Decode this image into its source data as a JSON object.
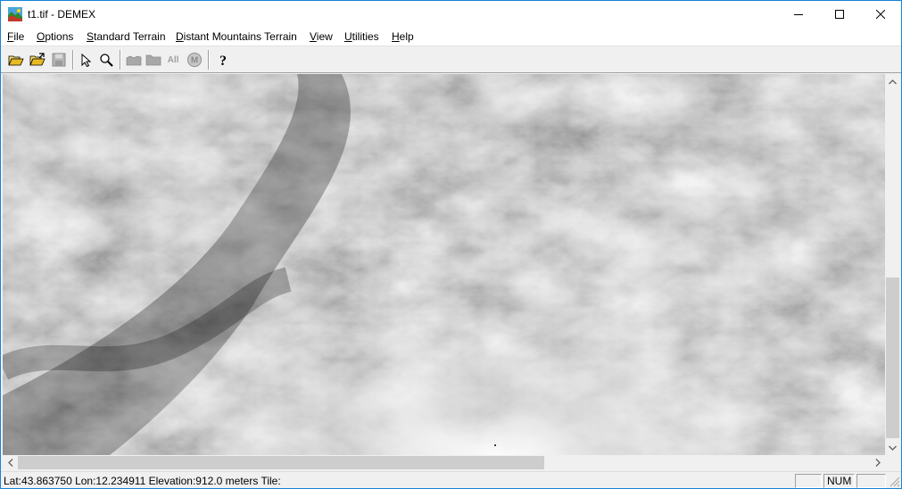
{
  "window": {
    "title": "t1.tif - DEMEX"
  },
  "menu": {
    "items": [
      {
        "label_u": "F",
        "label_rest": "ile"
      },
      {
        "label_u": "O",
        "label_rest": "ptions"
      },
      {
        "label_u": "S",
        "label_rest": "tandard Terrain"
      },
      {
        "label_u": "D",
        "label_rest": "istant Mountains Terrain"
      },
      {
        "label_u": "V",
        "label_rest": "iew"
      },
      {
        "label_u": "U",
        "label_rest": "tilities"
      },
      {
        "label_u": "H",
        "label_rest": "elp"
      }
    ]
  },
  "toolbar": {
    "buttons": [
      {
        "icon": "open-folder-icon",
        "enabled": true
      },
      {
        "icon": "open-folder-arrow-icon",
        "enabled": true
      },
      {
        "icon": "save-icon",
        "enabled": false
      },
      {
        "icon": "select-arrow-icon",
        "enabled": true
      },
      {
        "icon": "zoom-icon",
        "enabled": true
      },
      {
        "icon": "terrain-icon",
        "enabled": false
      },
      {
        "icon": "terrain-flat-icon",
        "enabled": false
      },
      {
        "icon": "all-icon",
        "enabled": false
      },
      {
        "icon": "m-circle-icon",
        "enabled": false
      },
      {
        "icon": "help-icon",
        "enabled": true
      }
    ],
    "all_label": "All",
    "m_label": "M",
    "help_label": "?"
  },
  "statusbar": {
    "text": "Lat:43.863750 Lon:12.234911 Elevation:912.0 meters Tile:",
    "pane1": "",
    "pane2": "NUM",
    "pane3": ""
  },
  "scroll": {
    "vertical_position": 0.53,
    "horizontal_position": 0.0
  },
  "colors": {
    "titlebar_border": "#1883d7",
    "chrome": "#f0f0f0",
    "dem_dark": "#3a3a3a",
    "dem_light": "#f2f2f2"
  }
}
